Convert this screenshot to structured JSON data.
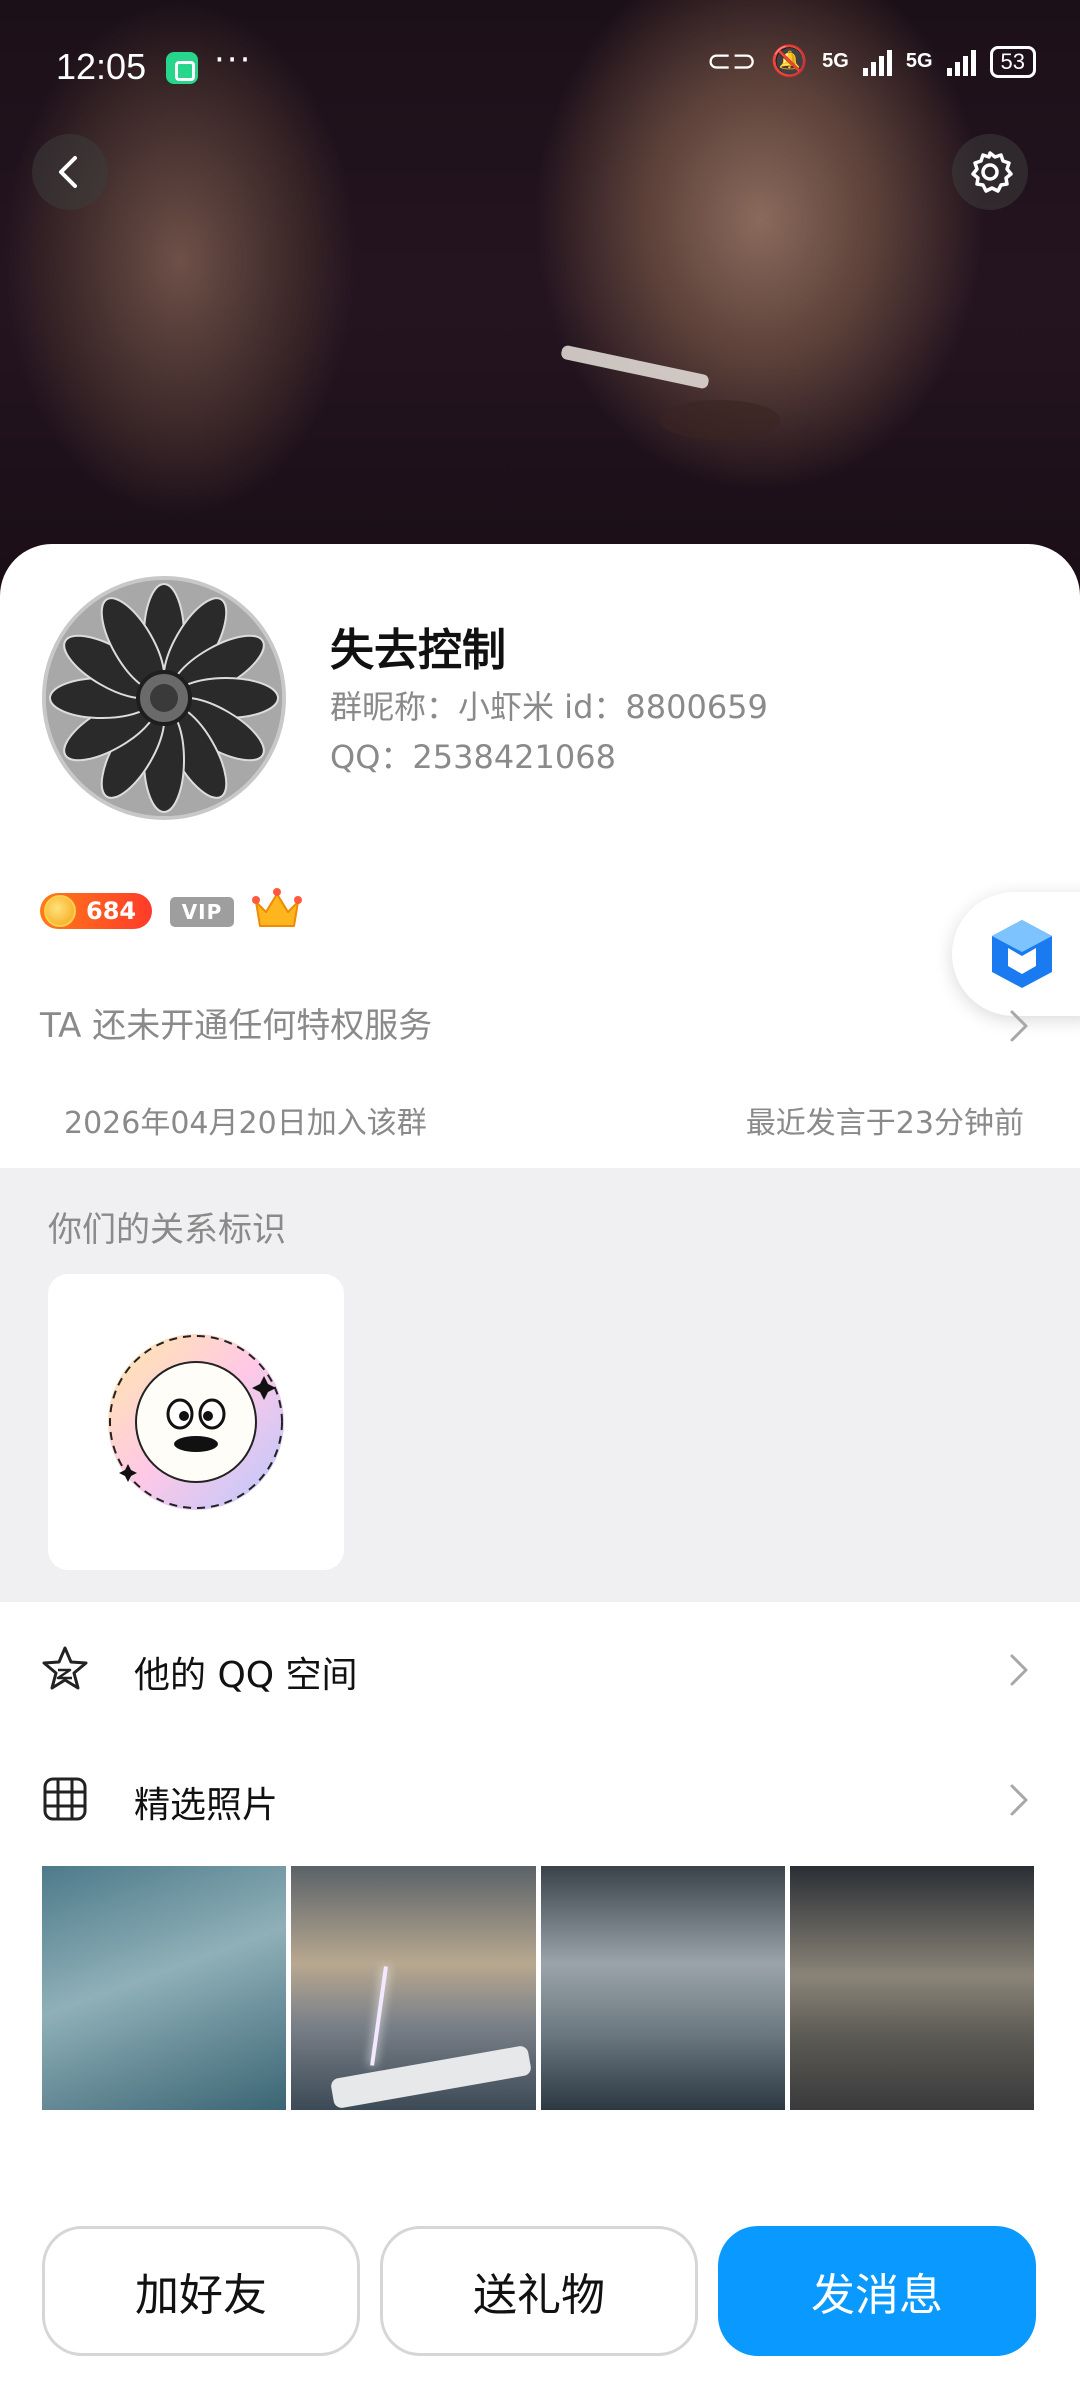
{
  "status_bar": {
    "time": "12:05",
    "signal1": "5G",
    "signal2": "5G",
    "battery": "53"
  },
  "header": {
    "back_icon": "chevron-left-icon",
    "settings_icon": "gear-icon"
  },
  "profile": {
    "name": "失去控制",
    "group_nick_line": "群昵称：小虾米 id：8800659",
    "qq_line": "QQ：2538421068",
    "level": "684",
    "vip_label": "VIP",
    "privilege_text": "TA 还未开通任何特权服务",
    "joined_text": "2026年04月20日加入该群",
    "last_speak_text": "最近发言于23分钟前"
  },
  "relationship": {
    "title": "你们的关系标识"
  },
  "menu": {
    "qzone_label": "他的 QQ 空间",
    "photos_label": "精选照片"
  },
  "actions": {
    "add_friend": "加好友",
    "send_gift": "送礼物",
    "send_message": "发消息"
  },
  "colors": {
    "primary_blue": "#0a99ff",
    "badge_orange": "#ff5a20"
  }
}
